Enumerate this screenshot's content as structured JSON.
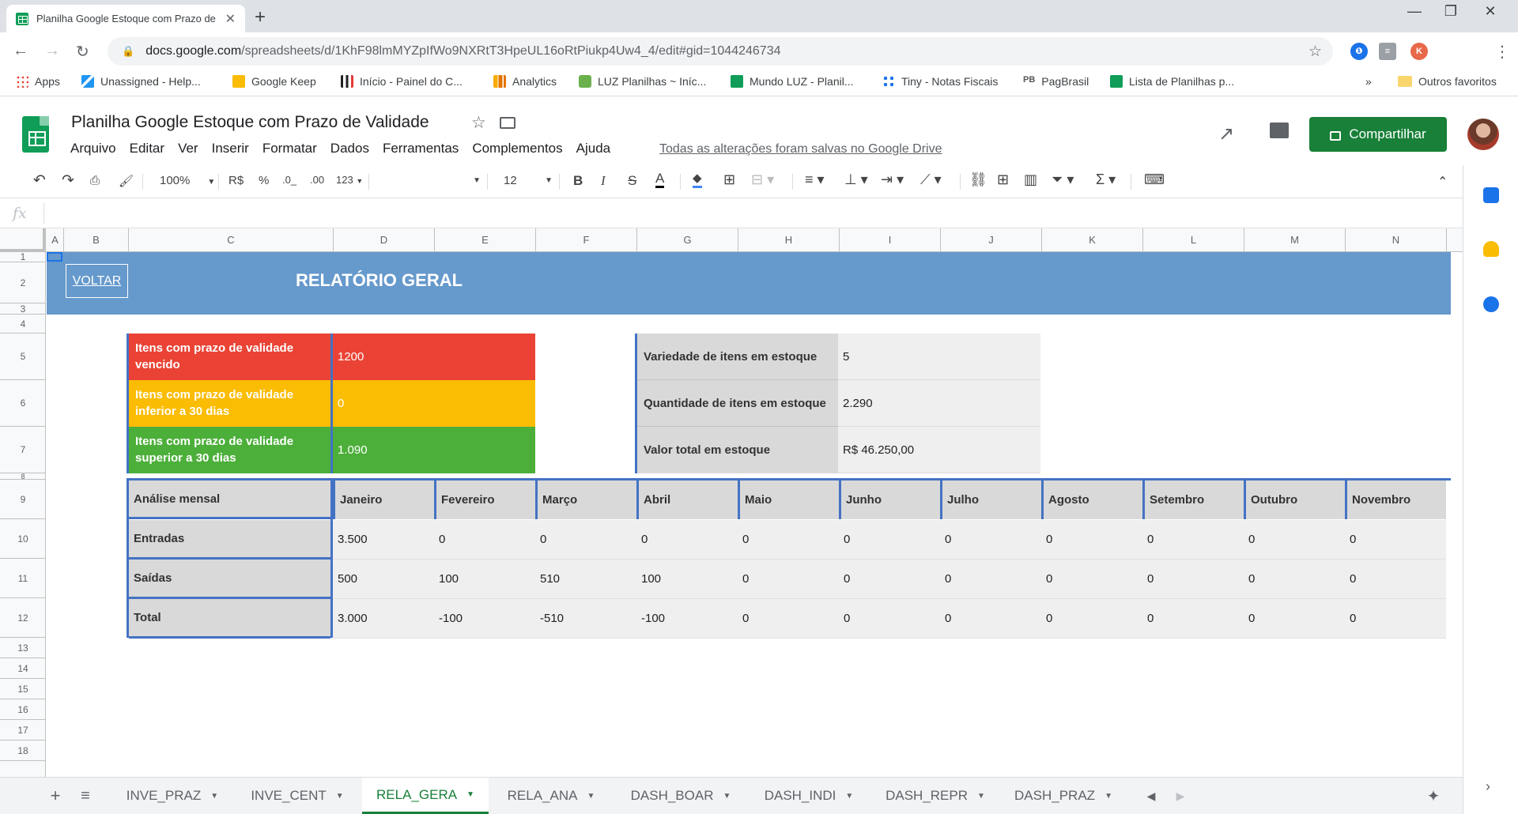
{
  "browser": {
    "tab_title": "Planilha Google Estoque com Prazo de Validade - Google Planilhas",
    "url_host": "docs.google.com",
    "url_path": "/spreadsheets/d/1KhF98lmMYZpIfWo9NXRtT3HpeUL16oRtPiukp4Uw4_4/edit#gid=1044246734",
    "bookmarks": [
      "Apps",
      "Unassigned - Help...",
      "Google Keep",
      "Início - Painel do C...",
      "Analytics",
      "LUZ Planilhas ~ Iníc...",
      "Mundo LUZ - Planil...",
      "Tiny - Notas Fiscais",
      "PagBrasil",
      "Lista de Planilhas p..."
    ],
    "bookmarks_more": "»",
    "other_bookmarks": "Outros favoritos",
    "ext_k": "K"
  },
  "app": {
    "doc_title": "Planilha Google Estoque com Prazo de Validade",
    "menu": [
      "Arquivo",
      "Editar",
      "Ver",
      "Inserir",
      "Formatar",
      "Dados",
      "Ferramentas",
      "Complementos",
      "Ajuda"
    ],
    "saved_status": "Todas as alterações foram salvas no Google Drive",
    "share_label": "Compartilhar"
  },
  "toolbar": {
    "zoom": "100%",
    "currency": "R$",
    "percent": "%",
    "dec_less": ".0_",
    "dec_more": ".00",
    "format_more": "123",
    "font_family": "",
    "font_size": "12"
  },
  "formula": {
    "fx_label": "fx",
    "content": ""
  },
  "grid": {
    "columns": [
      "A",
      "B",
      "C",
      "D",
      "E",
      "F",
      "G",
      "H",
      "I",
      "J",
      "K",
      "L",
      "M",
      "N"
    ],
    "rows": [
      "1",
      "2",
      "3",
      "4",
      "5",
      "6",
      "7",
      "8",
      "9",
      "10",
      "11",
      "12",
      "13",
      "14",
      "15",
      "16",
      "17",
      "18"
    ]
  },
  "report": {
    "back_link": "VOLTAR",
    "title": "RELATÓRIO GERAL",
    "kpis": [
      {
        "label": "Itens com prazo de validade vencido",
        "value": "1200",
        "color": "#ea4335"
      },
      {
        "label": "Itens com prazo de validade inferior a 30 dias",
        "value": "0",
        "color": "#fbbc04"
      },
      {
        "label": "Itens com prazo de validade superior a 30 dias",
        "value": "1.090",
        "color": "#4caf3a"
      }
    ],
    "info": [
      {
        "label": "Variedade de itens em estoque",
        "value": "5"
      },
      {
        "label": "Quantidade de itens em estoque",
        "value": "2.290"
      },
      {
        "label": "Valor total em estoque",
        "value": "R$ 46.250,00"
      }
    ],
    "monthly": {
      "header": "Análise mensal",
      "months": [
        "Janeiro",
        "Fevereiro",
        "Março",
        "Abril",
        "Maio",
        "Junho",
        "Julho",
        "Agosto",
        "Setembro",
        "Outubro",
        "Novembro"
      ],
      "rows": [
        {
          "label": "Entradas",
          "values": [
            "3.500",
            "0",
            "0",
            "0",
            "0",
            "0",
            "0",
            "0",
            "0",
            "0",
            "0"
          ]
        },
        {
          "label": "Saídas",
          "values": [
            "500",
            "100",
            "510",
            "100",
            "0",
            "0",
            "0",
            "0",
            "0",
            "0",
            "0"
          ]
        },
        {
          "label": "Total",
          "values": [
            "3.000",
            "-100",
            "-510",
            "-100",
            "0",
            "0",
            "0",
            "0",
            "0",
            "0",
            "0"
          ]
        }
      ]
    }
  },
  "sheet_tabs": {
    "tabs": [
      "INVE_PRAZ",
      "INVE_CENT",
      "RELA_GERA",
      "RELA_ANA",
      "DASH_BOAR",
      "DASH_INDI",
      "DASH_REPR",
      "DASH_PRAZ"
    ],
    "active": "RELA_GERA"
  },
  "colors": {
    "banner": "#6699cc",
    "share": "#188038",
    "accent_border": "#4472c4"
  }
}
